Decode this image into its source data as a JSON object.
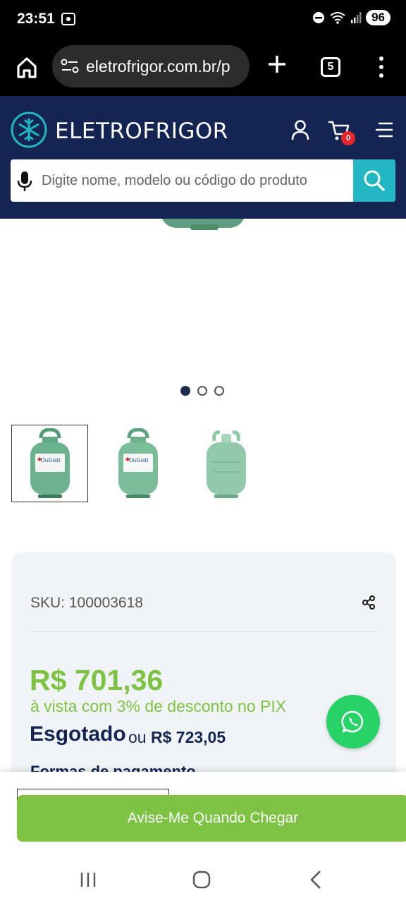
{
  "status_bar": {
    "time": "23:51",
    "battery": "96"
  },
  "browser": {
    "url": "eletrofrigor.com.br/p",
    "tab_count": "5"
  },
  "site": {
    "logo_text": "ELETROFRIGOR",
    "cart_count": "0",
    "search_placeholder": "Digite nome, modelo ou código do produto"
  },
  "product": {
    "sku": "SKU: 100003618",
    "price_main": "R$ 701,36",
    "price_note": "à vista com 3% de desconto no PIX",
    "stock_status": "Esgotado",
    "price_or_prefix": "ou ",
    "price_or_value": "R$ 723,05",
    "payment_title": "Formas de pagamento",
    "thumbnail_brand": "DuGold"
  },
  "actions": {
    "notify_label": "Avise-Me Quando Chegar"
  },
  "colors": {
    "header": "#142553",
    "accent": "#7dc242",
    "search_button": "#22b7c3",
    "whatsapp": "#25d366"
  }
}
